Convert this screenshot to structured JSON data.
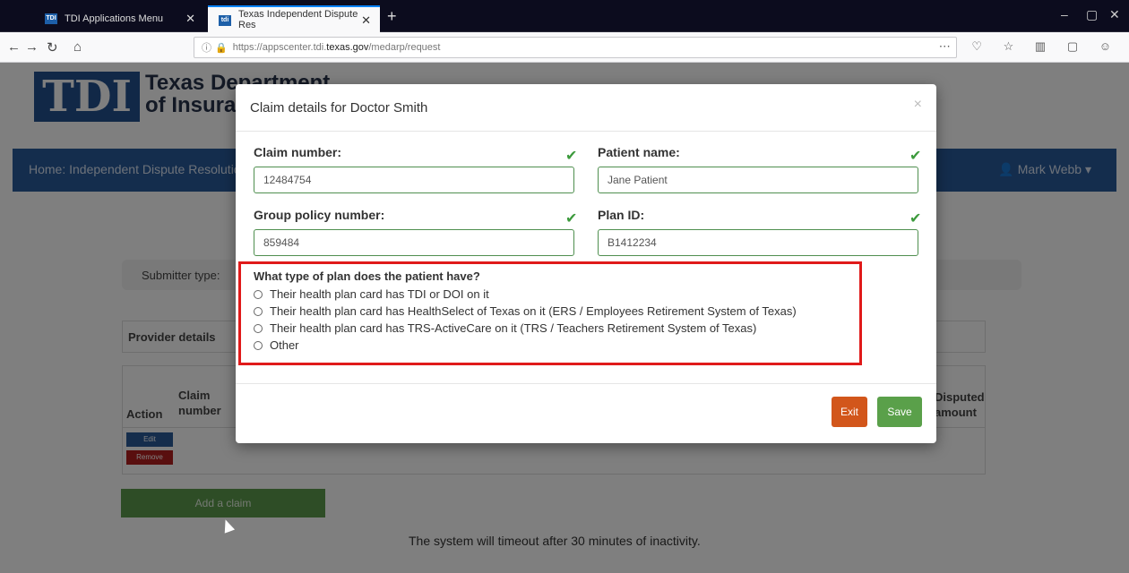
{
  "browser": {
    "tabs": [
      {
        "label": "TDI Applications Menu",
        "favicon": "TDI"
      },
      {
        "label": "Texas Independent Dispute Res",
        "favicon": "tdi"
      }
    ],
    "url_prefix": "https://appscenter.tdi.",
    "url_host": "texas.gov",
    "url_path": "/medarp/request"
  },
  "page": {
    "logo": "TDI",
    "agency_line1": "Texas Department",
    "agency_line2": "of Insurance",
    "breadcrumb": "Home: Independent Dispute Resolution",
    "user": "Mark Webb",
    "submitter_label": "Submitter type:",
    "provider_label": "Provider details",
    "table_headers": {
      "action": "Action",
      "claim": "Claim number",
      "disputed": "Disputed amount"
    },
    "edit": "Edit",
    "remove": "Remove",
    "add_claim": "Add a claim",
    "timeout": "The system will timeout after 30 minutes of inactivity."
  },
  "modal": {
    "title": "Claim details for Doctor Smith",
    "close": "×",
    "claim_number_label": "Claim number:",
    "claim_number_value": "12484754",
    "patient_name_label": "Patient name:",
    "patient_name_value": "Jane Patient",
    "group_policy_label": "Group policy number:",
    "group_policy_value": "859484",
    "plan_id_label": "Plan ID:",
    "plan_id_value": "B1412234",
    "plan_question": "What type of plan does the patient have?",
    "plan_options": [
      "Their health plan card has TDI or DOI on it",
      "Their health plan card has HealthSelect of Texas on it (ERS / Employees Retirement System of Texas)",
      "Their health plan card has TRS-ActiveCare on it (TRS / Teachers Retirement System of Texas)",
      "Other"
    ],
    "exit": "Exit",
    "save": "Save"
  }
}
